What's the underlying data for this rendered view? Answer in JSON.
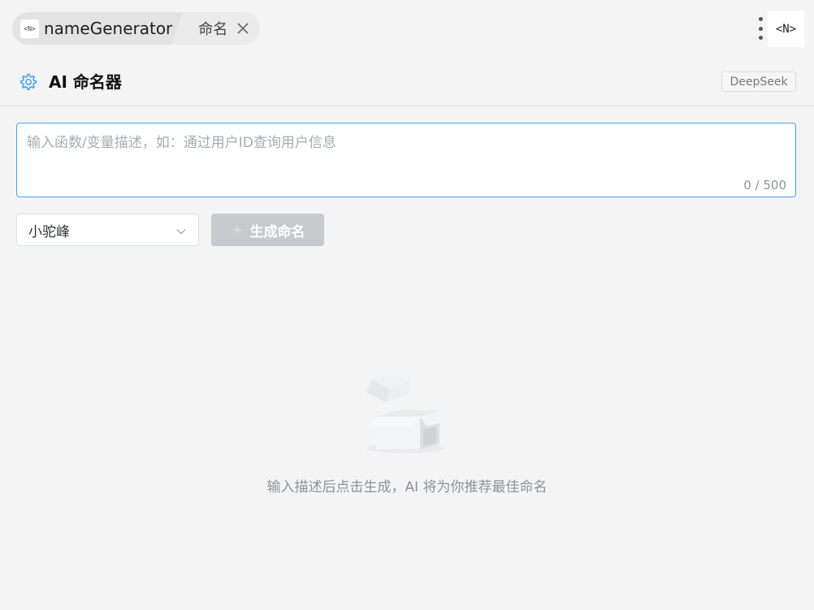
{
  "tabs": {
    "main_logo": "<N>",
    "main_label": "nameGenerator",
    "sub_label": "命名"
  },
  "app_logo": "<N>",
  "header": {
    "title": "AI 命名器",
    "model_badge": "DeepSeek"
  },
  "description_input": {
    "placeholder": "输入函数/变量描述，如：通过用户ID查询用户信息",
    "value": "",
    "counter": "0 / 500"
  },
  "style_select": {
    "selected": "小驼峰"
  },
  "generate_button": {
    "label": "生成命名",
    "enabled": false
  },
  "empty_state": {
    "text": "输入描述后点击生成，AI 将为你推荐最佳命名"
  },
  "icons": {
    "settings": "gear-icon",
    "close": "close-icon",
    "more": "kebab-menu-icon",
    "dropdown": "chevron-down-icon",
    "generate": "sparkle-icon",
    "empty": "empty-box-icon"
  },
  "colors": {
    "accent": "#409eff",
    "button_disabled": "#c8c9cc",
    "background": "#f4f4f4"
  }
}
